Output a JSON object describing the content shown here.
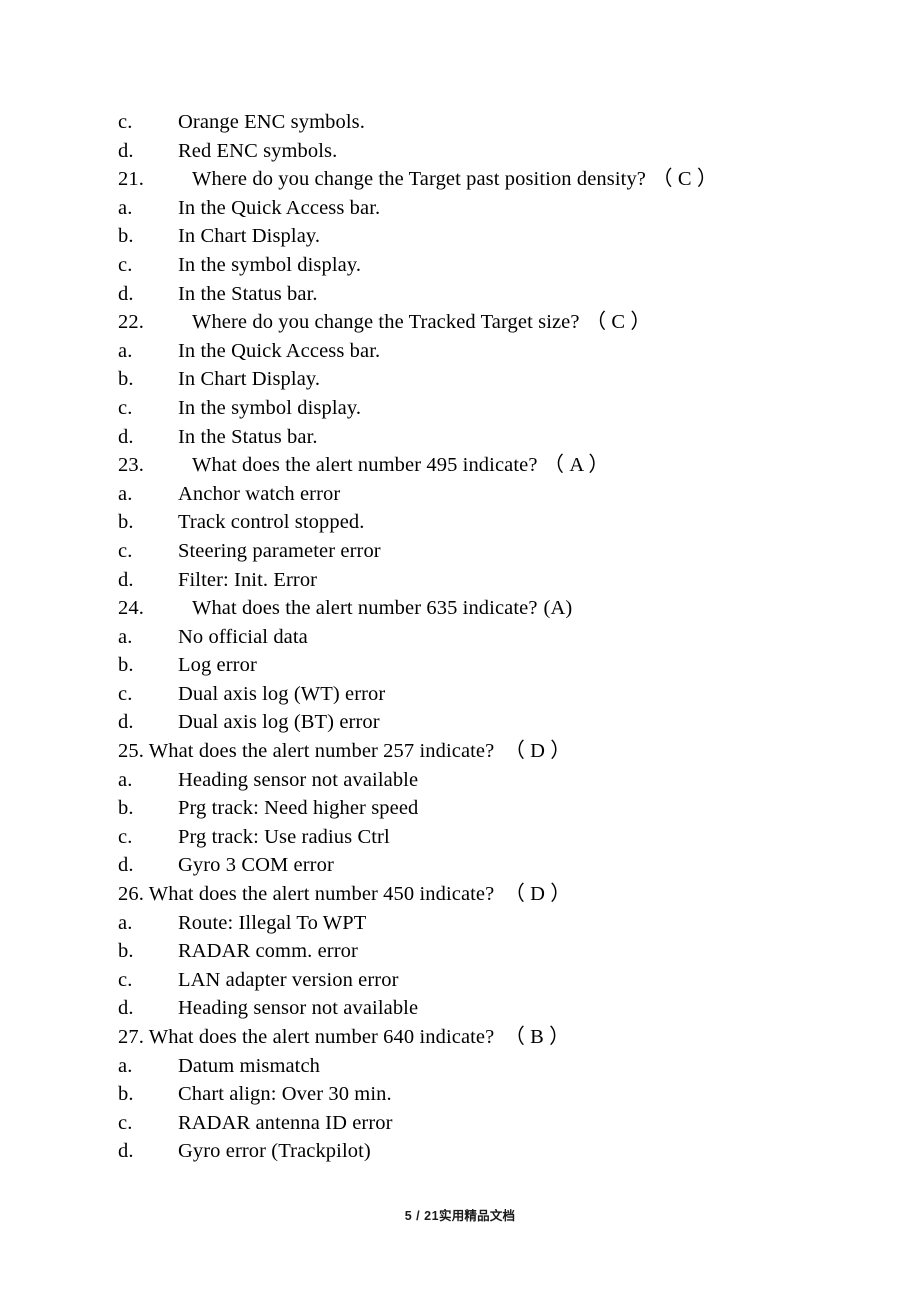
{
  "document": {
    "footer": {
      "page_label": "5 / 21",
      "watermark": "实用精品文档"
    }
  },
  "blocks": [
    {
      "kind": "option",
      "label": "c.",
      "text": "Orange ENC symbols."
    },
    {
      "kind": "option",
      "label": "d.",
      "text": "Red ENC symbols."
    },
    {
      "kind": "question_indent",
      "number": "21.",
      "text": "Where do you change the Target past position density?",
      "answer": "（ C ）"
    },
    {
      "kind": "option",
      "label": "a.",
      "text": "In the Quick Access bar."
    },
    {
      "kind": "option",
      "label": "b.",
      "text": "In Chart Display."
    },
    {
      "kind": "option",
      "label": "c.",
      "text": "In the symbol display."
    },
    {
      "kind": "option",
      "label": "d.",
      "text": "In the Status bar."
    },
    {
      "kind": "question_indent",
      "number": "22.",
      "text": "Where do you change the Tracked Target size?",
      "answer": "（ C ）"
    },
    {
      "kind": "option",
      "label": "a.",
      "text": "In the Quick Access bar."
    },
    {
      "kind": "option",
      "label": "b.",
      "text": "In Chart Display."
    },
    {
      "kind": "option",
      "label": "c.",
      "text": "In the symbol display."
    },
    {
      "kind": "option",
      "label": "d.",
      "text": "In the Status bar."
    },
    {
      "kind": "question_indent",
      "number": "23.",
      "text": "What does the alert number 495 indicate?",
      "answer": "（ A ）"
    },
    {
      "kind": "option",
      "label": "a.",
      "text": "Anchor watch error"
    },
    {
      "kind": "option",
      "label": "b.",
      "text": "Track control stopped."
    },
    {
      "kind": "option",
      "label": "c.",
      "text": "Steering parameter error"
    },
    {
      "kind": "option",
      "label": "d.",
      "text": "Filter: Init. Error"
    },
    {
      "kind": "question_indent",
      "number": "24.",
      "text": "What does the alert number 635 indicate?",
      "answer": "(A)"
    },
    {
      "kind": "option",
      "label": "a.",
      "text": "No official data"
    },
    {
      "kind": "option",
      "label": "b.",
      "text": "Log error"
    },
    {
      "kind": "option",
      "label": "c.",
      "text": "Dual axis log (WT) error"
    },
    {
      "kind": "option",
      "label": "d.",
      "text": "Dual axis log (BT) error"
    },
    {
      "kind": "question_flush",
      "number": "25.",
      "text": "What does the alert number 257 indicate?",
      "answer": "（ D ）"
    },
    {
      "kind": "option",
      "label": "a.",
      "text": "Heading sensor not available"
    },
    {
      "kind": "option",
      "label": "b.",
      "text": "Prg track: Need higher speed"
    },
    {
      "kind": "option",
      "label": "c.",
      "text": "Prg track: Use radius Ctrl"
    },
    {
      "kind": "option",
      "label": "d.",
      "text": "Gyro 3 COM error"
    },
    {
      "kind": "question_flush",
      "number": "26.",
      "text": "What does the alert number 450 indicate?",
      "answer": "（ D ）"
    },
    {
      "kind": "option",
      "label": "a.",
      "text": "Route: Illegal To WPT"
    },
    {
      "kind": "option",
      "label": "b.",
      "text": "RADAR comm. error"
    },
    {
      "kind": "option",
      "label": "c.",
      "text": "LAN adapter version error"
    },
    {
      "kind": "option",
      "label": "d.",
      "text": "Heading sensor not available"
    },
    {
      "kind": "question_flush",
      "number": "27.",
      "text": "What does the alert number 640 indicate?",
      "answer": "（ B ）"
    },
    {
      "kind": "option",
      "label": "a.",
      "text": "Datum mismatch"
    },
    {
      "kind": "option",
      "label": "b.",
      "text": "Chart align: Over 30 min."
    },
    {
      "kind": "option",
      "label": "c.",
      "text": "RADAR antenna ID error"
    },
    {
      "kind": "option",
      "label": "d.",
      "text": "Gyro error (Trackpilot)"
    }
  ]
}
